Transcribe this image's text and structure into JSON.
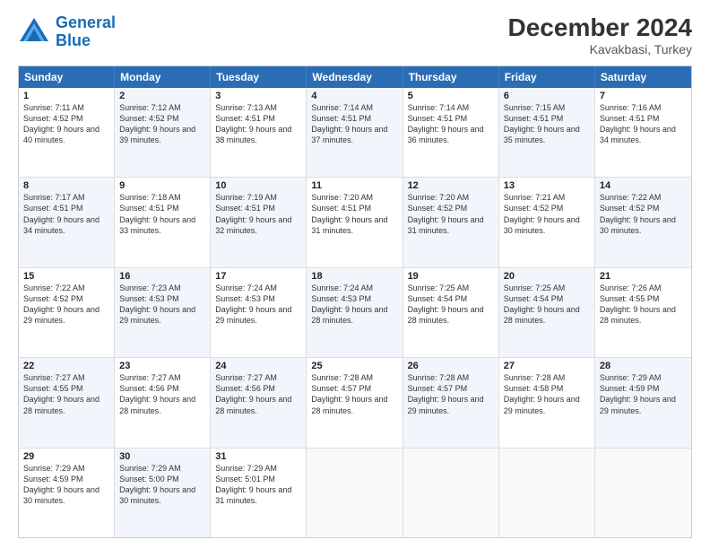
{
  "logo": {
    "line1": "General",
    "line2": "Blue"
  },
  "title": "December 2024",
  "subtitle": "Kavakbasi, Turkey",
  "days": [
    "Sunday",
    "Monday",
    "Tuesday",
    "Wednesday",
    "Thursday",
    "Friday",
    "Saturday"
  ],
  "weeks": [
    [
      {
        "day": "1",
        "sunrise": "7:11 AM",
        "sunset": "4:52 PM",
        "daylight": "9 hours and 40 minutes.",
        "bg": "white"
      },
      {
        "day": "2",
        "sunrise": "7:12 AM",
        "sunset": "4:52 PM",
        "daylight": "9 hours and 39 minutes.",
        "bg": "alt"
      },
      {
        "day": "3",
        "sunrise": "7:13 AM",
        "sunset": "4:51 PM",
        "daylight": "9 hours and 38 minutes.",
        "bg": "white"
      },
      {
        "day": "4",
        "sunrise": "7:14 AM",
        "sunset": "4:51 PM",
        "daylight": "9 hours and 37 minutes.",
        "bg": "alt"
      },
      {
        "day": "5",
        "sunrise": "7:14 AM",
        "sunset": "4:51 PM",
        "daylight": "9 hours and 36 minutes.",
        "bg": "white"
      },
      {
        "day": "6",
        "sunrise": "7:15 AM",
        "sunset": "4:51 PM",
        "daylight": "9 hours and 35 minutes.",
        "bg": "alt"
      },
      {
        "day": "7",
        "sunrise": "7:16 AM",
        "sunset": "4:51 PM",
        "daylight": "9 hours and 34 minutes.",
        "bg": "white"
      }
    ],
    [
      {
        "day": "8",
        "sunrise": "7:17 AM",
        "sunset": "4:51 PM",
        "daylight": "9 hours and 34 minutes.",
        "bg": "alt"
      },
      {
        "day": "9",
        "sunrise": "7:18 AM",
        "sunset": "4:51 PM",
        "daylight": "9 hours and 33 minutes.",
        "bg": "white"
      },
      {
        "day": "10",
        "sunrise": "7:19 AM",
        "sunset": "4:51 PM",
        "daylight": "9 hours and 32 minutes.",
        "bg": "alt"
      },
      {
        "day": "11",
        "sunrise": "7:20 AM",
        "sunset": "4:51 PM",
        "daylight": "9 hours and 31 minutes.",
        "bg": "white"
      },
      {
        "day": "12",
        "sunrise": "7:20 AM",
        "sunset": "4:52 PM",
        "daylight": "9 hours and 31 minutes.",
        "bg": "alt"
      },
      {
        "day": "13",
        "sunrise": "7:21 AM",
        "sunset": "4:52 PM",
        "daylight": "9 hours and 30 minutes.",
        "bg": "white"
      },
      {
        "day": "14",
        "sunrise": "7:22 AM",
        "sunset": "4:52 PM",
        "daylight": "9 hours and 30 minutes.",
        "bg": "alt"
      }
    ],
    [
      {
        "day": "15",
        "sunrise": "7:22 AM",
        "sunset": "4:52 PM",
        "daylight": "9 hours and 29 minutes.",
        "bg": "white"
      },
      {
        "day": "16",
        "sunrise": "7:23 AM",
        "sunset": "4:53 PM",
        "daylight": "9 hours and 29 minutes.",
        "bg": "alt"
      },
      {
        "day": "17",
        "sunrise": "7:24 AM",
        "sunset": "4:53 PM",
        "daylight": "9 hours and 29 minutes.",
        "bg": "white"
      },
      {
        "day": "18",
        "sunrise": "7:24 AM",
        "sunset": "4:53 PM",
        "daylight": "9 hours and 28 minutes.",
        "bg": "alt"
      },
      {
        "day": "19",
        "sunrise": "7:25 AM",
        "sunset": "4:54 PM",
        "daylight": "9 hours and 28 minutes.",
        "bg": "white"
      },
      {
        "day": "20",
        "sunrise": "7:25 AM",
        "sunset": "4:54 PM",
        "daylight": "9 hours and 28 minutes.",
        "bg": "alt"
      },
      {
        "day": "21",
        "sunrise": "7:26 AM",
        "sunset": "4:55 PM",
        "daylight": "9 hours and 28 minutes.",
        "bg": "white"
      }
    ],
    [
      {
        "day": "22",
        "sunrise": "7:27 AM",
        "sunset": "4:55 PM",
        "daylight": "9 hours and 28 minutes.",
        "bg": "alt"
      },
      {
        "day": "23",
        "sunrise": "7:27 AM",
        "sunset": "4:56 PM",
        "daylight": "9 hours and 28 minutes.",
        "bg": "white"
      },
      {
        "day": "24",
        "sunrise": "7:27 AM",
        "sunset": "4:56 PM",
        "daylight": "9 hours and 28 minutes.",
        "bg": "alt"
      },
      {
        "day": "25",
        "sunrise": "7:28 AM",
        "sunset": "4:57 PM",
        "daylight": "9 hours and 28 minutes.",
        "bg": "white"
      },
      {
        "day": "26",
        "sunrise": "7:28 AM",
        "sunset": "4:57 PM",
        "daylight": "9 hours and 29 minutes.",
        "bg": "alt"
      },
      {
        "day": "27",
        "sunrise": "7:28 AM",
        "sunset": "4:58 PM",
        "daylight": "9 hours and 29 minutes.",
        "bg": "white"
      },
      {
        "day": "28",
        "sunrise": "7:29 AM",
        "sunset": "4:59 PM",
        "daylight": "9 hours and 29 minutes.",
        "bg": "alt"
      }
    ],
    [
      {
        "day": "29",
        "sunrise": "7:29 AM",
        "sunset": "4:59 PM",
        "daylight": "9 hours and 30 minutes.",
        "bg": "white"
      },
      {
        "day": "30",
        "sunrise": "7:29 AM",
        "sunset": "5:00 PM",
        "daylight": "9 hours and 30 minutes.",
        "bg": "alt"
      },
      {
        "day": "31",
        "sunrise": "7:29 AM",
        "sunset": "5:01 PM",
        "daylight": "9 hours and 31 minutes.",
        "bg": "white"
      },
      {
        "day": "",
        "sunrise": "",
        "sunset": "",
        "daylight": "",
        "bg": "empty"
      },
      {
        "day": "",
        "sunrise": "",
        "sunset": "",
        "daylight": "",
        "bg": "empty"
      },
      {
        "day": "",
        "sunrise": "",
        "sunset": "",
        "daylight": "",
        "bg": "empty"
      },
      {
        "day": "",
        "sunrise": "",
        "sunset": "",
        "daylight": "",
        "bg": "empty"
      }
    ]
  ]
}
